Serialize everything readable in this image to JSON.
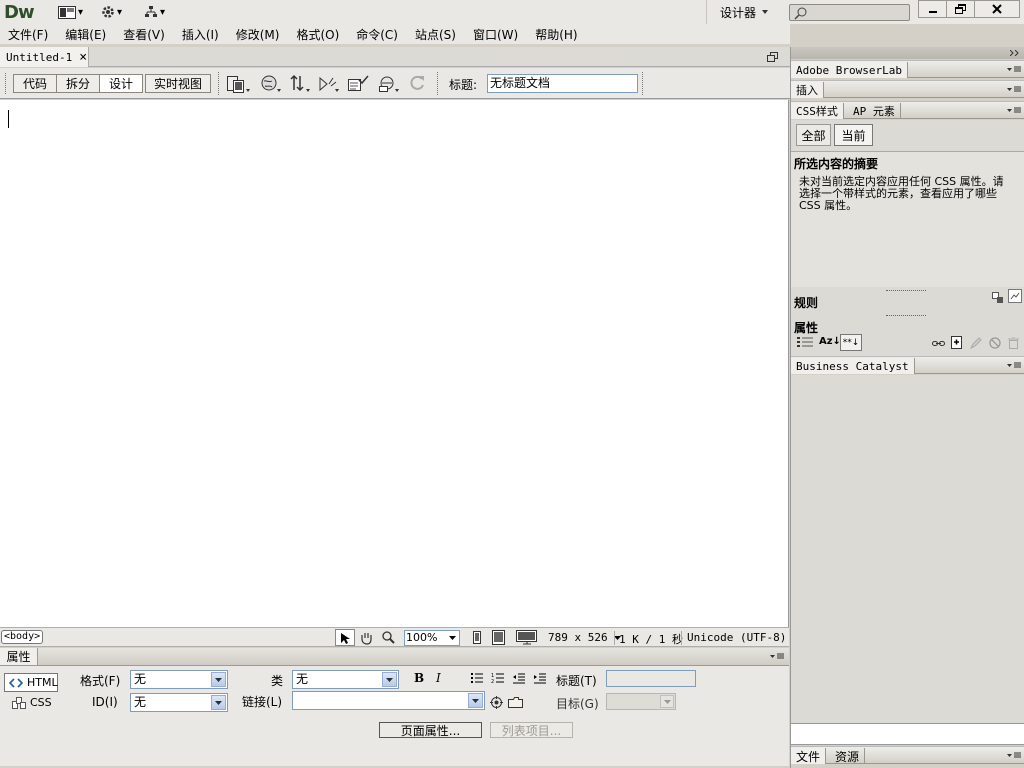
{
  "app": {
    "logo": "Dw",
    "workspace": "设计器",
    "workspace_arrow": "▾",
    "layout_arrow": "▾",
    "extend_arrow": "▾",
    "site_arrow": "▾"
  },
  "menu": [
    "文件(F)",
    "编辑(E)",
    "查看(V)",
    "插入(I)",
    "修改(M)",
    "格式(O)",
    "命令(C)",
    "站点(S)",
    "窗口(W)",
    "帮助(H)"
  ],
  "document": {
    "tab_name": "Untitled-1",
    "close_glyph": "×",
    "view_buttons": [
      "代码",
      "拆分",
      "设计",
      "实时视图"
    ],
    "active_view": "设计",
    "title_label": "标题:",
    "title_value": "无标题文档"
  },
  "status": {
    "tag": "<body>",
    "zoom": "100%",
    "dimensions": "789 x 526",
    "size_time": "1 K / 1 秒",
    "encoding": "Unicode (UTF-8)"
  },
  "properties": {
    "header": "属性",
    "html_label": "HTML",
    "css_label": "CSS",
    "format_label": "格式(F)",
    "format_value": "无",
    "id_label": "ID(I)",
    "id_value": "无",
    "class_label": "类",
    "class_value": "无",
    "link_label": "链接(L)",
    "link_value": "",
    "title_label": "标题(T)",
    "title_value": "",
    "target_label": "目标(G)",
    "target_value": "",
    "bold": "B",
    "italic": "I",
    "page_props_button": "页面属性...",
    "list_item_button": "列表项目..."
  },
  "right_panel": {
    "browserlab_tab": "Adobe BrowserLab",
    "insert_tab": "插入",
    "css_tabs": [
      "CSS样式",
      "AP 元素"
    ],
    "css_modes": [
      "全部",
      "当前"
    ],
    "active_css_mode": "当前",
    "summary_title": "所选内容的摘要",
    "summary_text": "未对当前选定内容应用任何 CSS 属性。请选择一个带样式的元素，查看应用了哪些 CSS 属性。",
    "rules_label": "规则",
    "props_label": "属性",
    "sort_az": "Az↓",
    "sort_star": "**↓",
    "business_tab": "Business Catalyst",
    "bottom_tabs": [
      "文件",
      "资源"
    ]
  }
}
